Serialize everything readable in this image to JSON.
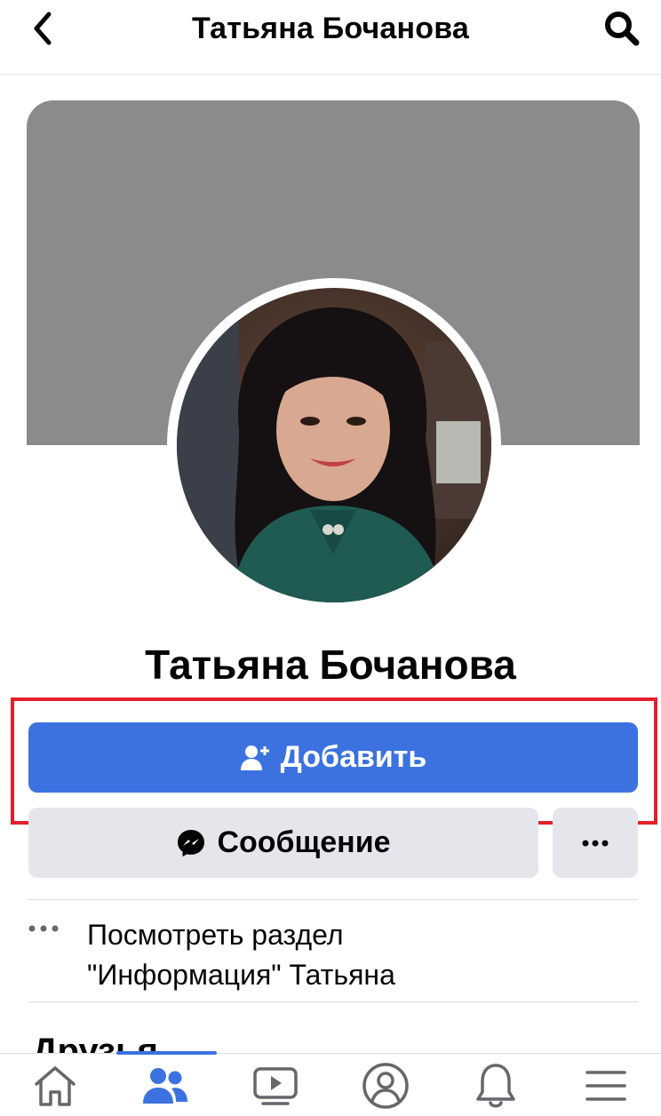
{
  "header": {
    "title": "Татьяна Бочанова",
    "back_icon": "chevron-left-icon",
    "search_icon": "search-icon"
  },
  "profile": {
    "name": "Татьяна Бочанова",
    "cover_color": "#8a8b8d",
    "avatar_alt": "profile photo"
  },
  "actions": {
    "add_label": "Добавить",
    "add_icon": "add-friend-icon",
    "message_label": "Сообщение",
    "message_icon": "messenger-icon",
    "more_icon": "more-horizontal-icon"
  },
  "about": {
    "text_line1": "Посмотреть раздел",
    "text_line2": "\"Информация\" Татьяна",
    "icon": "more-horizontal-icon"
  },
  "friends": {
    "title": "Друзья"
  },
  "tabs": [
    {
      "name": "home",
      "icon": "home-icon",
      "active": false
    },
    {
      "name": "friends",
      "icon": "friends-icon",
      "active": true
    },
    {
      "name": "watch",
      "icon": "video-icon",
      "active": false
    },
    {
      "name": "profile",
      "icon": "profile-icon",
      "active": false
    },
    {
      "name": "notifications",
      "icon": "bell-icon",
      "active": false
    },
    {
      "name": "menu",
      "icon": "menu-icon",
      "active": false
    }
  ],
  "colors": {
    "accent": "#3b72df",
    "highlight": "#e3202c",
    "button_gray": "#e4e6eb"
  }
}
